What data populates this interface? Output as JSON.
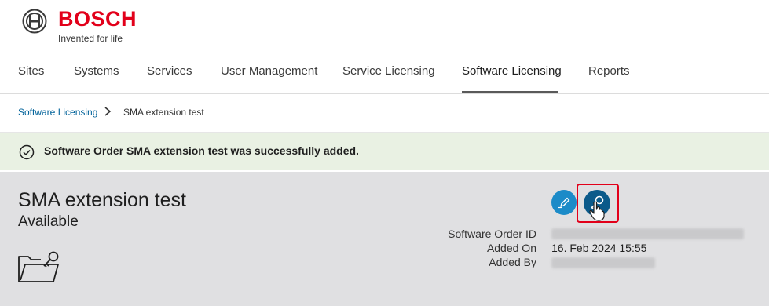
{
  "brand": {
    "name": "BOSCH",
    "tagline": "Invented for life",
    "accent": "#e2001a"
  },
  "nav": {
    "items": [
      {
        "label": "Sites"
      },
      {
        "label": "Systems"
      },
      {
        "label": "Services"
      },
      {
        "label": "User Management"
      },
      {
        "label": "Service Licensing"
      },
      {
        "label": "Software Licensing",
        "active": true
      },
      {
        "label": "Reports"
      }
    ]
  },
  "breadcrumb": {
    "parent": "Software Licensing",
    "current": "SMA extension test"
  },
  "banner": {
    "icon": "check-circle-icon",
    "text": "Software Order SMA extension test was successfully added.",
    "bg": "#e9f1e3"
  },
  "order": {
    "title": "SMA extension test",
    "status": "Available",
    "fields": {
      "order_id_label": "Software Order ID",
      "added_on_label": "Added On",
      "added_on_value": "16. Feb 2024 15:55",
      "added_by_label": "Added By"
    },
    "actions": {
      "edit_icon": "pencil-icon",
      "license_icon": "key-icon"
    }
  }
}
